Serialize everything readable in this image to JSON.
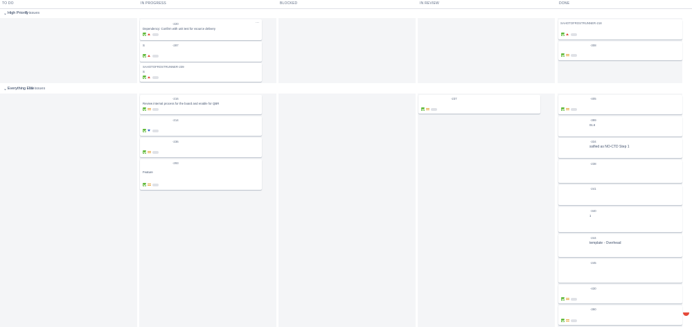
{
  "columns": [
    {
      "title": "TO DO"
    },
    {
      "title": "IN PROGRESS"
    },
    {
      "title": "BLOCKED"
    },
    {
      "title": "IN REVIEW"
    },
    {
      "title": "DONE"
    }
  ],
  "swimlanes": [
    {
      "title": "High Priority",
      "count": "5 issues"
    },
    {
      "title": "Everything Else",
      "count": "15 issues"
    }
  ],
  "cards": {
    "hp_inprogress": [
      {
        "key": "-220",
        "summary": "Dependency: Confirm with unit test for vsource delivery",
        "priority": "high"
      },
      {
        "key": "-287",
        "summary": "S",
        "priority": "high"
      },
      {
        "key": "SAHOTOFROSTRUNNER-239",
        "summary": "S",
        "priority": "high"
      }
    ],
    "hp_done": [
      {
        "key": "SAHOTOFROSTRUNNER-218",
        "summary": "",
        "priority": "high"
      },
      {
        "key": "-308",
        "summary": "",
        "priority": "med"
      }
    ],
    "ee_inprogress": [
      {
        "key": "-216",
        "summary": "Review internal process for the board and enable for QBR",
        "priority": "med"
      },
      {
        "key": "-214",
        "summary": "",
        "priority": "low"
      },
      {
        "key": "-236",
        "summary": "",
        "priority": "med"
      },
      {
        "key": "-293",
        "summary": "",
        "priority": "med",
        "extra": "Feature"
      }
    ],
    "ee_review": [
      {
        "key": "-237",
        "summary": "",
        "priority": "med"
      }
    ],
    "ee_done": [
      {
        "key": "-405",
        "summary": "",
        "priority": "med"
      },
      {
        "key": "-399",
        "summary": "01.6",
        "priority": "med"
      },
      {
        "key": "-334",
        "summary": "ssified as NO-CTD Step 1",
        "priority": "med"
      },
      {
        "key": "-238",
        "summary": "",
        "priority": "med"
      },
      {
        "key": "-241",
        "summary": "",
        "priority": "med"
      },
      {
        "key": "-340",
        "summary": "1",
        "priority": "med"
      },
      {
        "key": "-244",
        "summary": "template - Overhead",
        "priority": "med"
      },
      {
        "key": "-245",
        "summary": "",
        "priority": "med"
      },
      {
        "key": "-430",
        "summary": "",
        "priority": "med"
      },
      {
        "key": "-390",
        "summary": "",
        "priority": "med"
      }
    ]
  },
  "colors": {
    "lane_bg": "#f4f5f7",
    "story": "#63ba3c",
    "high": "#e5493a",
    "medium": "#e8a33a",
    "low": "#2a5fc6"
  }
}
